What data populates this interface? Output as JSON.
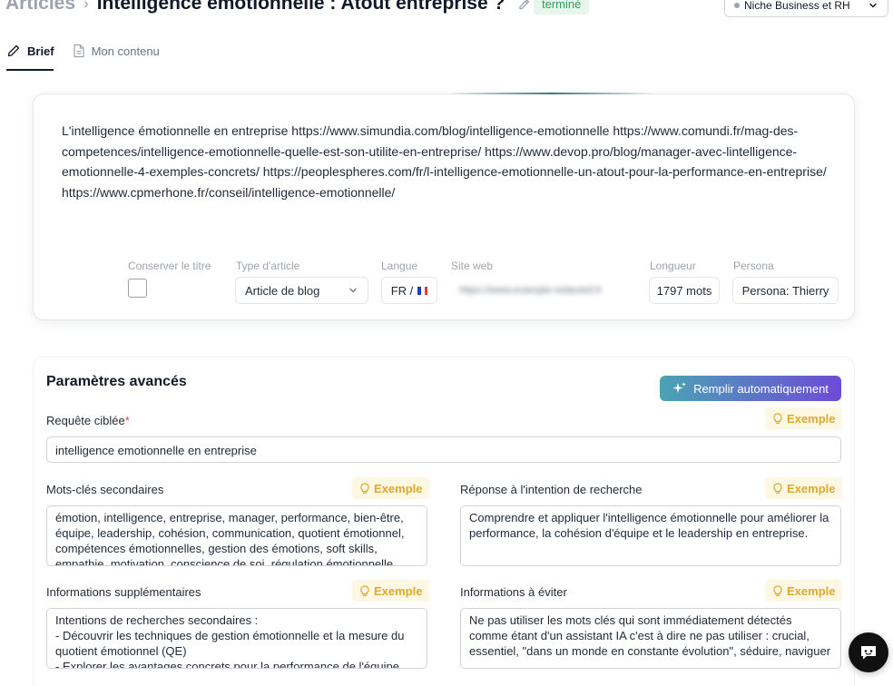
{
  "header": {
    "breadcrumb_root": "Articles",
    "separator": "›",
    "title": "Intelligence émotionnelle : Atout entreprise ?",
    "status": "terminé",
    "niche_select": "Niche Business et RH"
  },
  "tabs": [
    {
      "label": "Brief",
      "active": true,
      "icon": "pencil-icon"
    },
    {
      "label": "Mon contenu",
      "active": false,
      "icon": "document-icon"
    }
  ],
  "brief": {
    "text": "L'intelligence émotionnelle en entreprise https://www.simundia.com/blog/intelligence-emotionnelle https://www.comundi.fr/mag-des-competences/intelligence-emotionnelle-quelle-est-son-utilite-en-entreprise/ https://www.devop.pro/blog/manager-avec-lintelligence-emotionnelle-4-exemples-concrets/ https://peoplespheres.com/fr/l-intelligence-emotionnelle-un-atout-pour-la-performance-en-entreprise/ https://www.cpmerhone.fr/conseil/intelligence-emotionnelle/",
    "fields": {
      "conserve_label": "Conserver le titre",
      "conserve_checked": false,
      "type_label": "Type d'article",
      "type_value": "Article de blog",
      "lang_label": "Langue",
      "lang_value": "FR /",
      "site_label": "Site web",
      "site_value": "https://www.example-redacted.fr",
      "length_label": "Longueur",
      "length_value": "1797 mots",
      "persona_label": "Persona",
      "persona_value": "Persona: Thierry"
    }
  },
  "advanced": {
    "title": "Paramètres avancés",
    "autofill_label": "Remplir automatiquement",
    "example_label": "Exemple",
    "requete_label": "Requête ciblée",
    "requete_required": "*",
    "requete_value": "intelligence emotionnelle en entreprise",
    "mots_cles_label": "Mots-clés secondaires",
    "mots_cles_value": "émotion, intelligence, entreprise, manager, performance, bien-être, équipe, leadership, cohésion, communication, quotient émotionnel, compétences émotionnelles, gestion des émotions, soft skills, empathie, motivation, conscience de soi, régulation émotionnelle",
    "reponse_label": "Réponse à l'intention de recherche",
    "reponse_value": "Comprendre et appliquer l'intelligence émotionnelle pour améliorer la performance, la cohésion d'équipe et le leadership en entreprise.",
    "infos_sup_label": "Informations supplémentaires",
    "infos_sup_value": "Intentions de recherches secondaires :\n- Découvrir les techniques de gestion émotionnelle et la mesure du quotient émotionnel (QE)\n- Explorer les avantages concrets pour la performance de l'équipe",
    "infos_eviter_label": "Informations à éviter",
    "infos_eviter_value": "Ne pas utiliser les mots clés qui sont immédiatement détectés comme étant d'un assistant IA c'est à dire ne pas utiliser : crucial, essentiel, \"dans un monde en constante évolution\", séduire, naviguer"
  },
  "colors": {
    "status_bg": "#e7f6ec",
    "status_text": "#2f9e5a",
    "example_text": "#e0a92c",
    "autofill_gradient_start": "#4ba3b3",
    "autofill_gradient_end": "#6d4bd8"
  }
}
